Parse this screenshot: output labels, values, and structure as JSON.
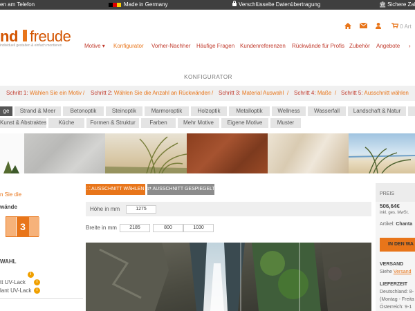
{
  "topbar": {
    "phone_text": "en am Telefon",
    "made_in": "Made in Germany",
    "secure": "Verschlüsselte Datenübertragung",
    "payment": "Sichere Zahl",
    "flag_colors": [
      "#000000",
      "#dd0000",
      "#ffce00"
    ]
  },
  "logo": {
    "text_a": "nd",
    "text_b": "freude",
    "tagline": "individuell gestalten & einfach montieren"
  },
  "header_icons": [
    "home-icon",
    "mail-icon",
    "user-icon"
  ],
  "cart": {
    "icon": "cart-icon",
    "count": "0",
    "label": "Art"
  },
  "nav": {
    "items": [
      "Motive ▾",
      "Konfigurator",
      "Vorher-Nachher",
      "Häufige Fragen",
      "Kundenreferenzen",
      "Rückwände für Profis",
      "Zubehör",
      "Angebote"
    ],
    "active": "Konfigurator"
  },
  "page_title": "KONFIGURATOR",
  "steps": [
    {
      "num": "Schritt 1:",
      "label": "Wählen Sie ein Motiv"
    },
    {
      "num": "Schritt 2:",
      "label": "Wählen Sie die Anzahl an Rückwänden"
    },
    {
      "num": "Schritt 3:",
      "label": "Material Auswahl"
    },
    {
      "num": "Schritt 4:",
      "label": "Maße"
    },
    {
      "num": "Schritt 5:",
      "label": "Ausschnitt wählen"
    }
  ],
  "categories_row1": [
    "ge",
    "Strand & Meer",
    "Betonoptik",
    "Steinoptik",
    "Marmoroptik",
    "Holzoptik",
    "Metalloptik",
    "Wellness",
    "Wasserfall",
    "Landschaft & Natur"
  ],
  "categories_row2": [
    "Kunst & Abstraktes",
    "Küche",
    "Formen & Struktur",
    "Farben",
    "Mehr Motive",
    "Eigene Motive",
    "Muster"
  ],
  "sidebar": {
    "motif_hint": "n Sie die",
    "walls_label": "wände",
    "walls_count": "3",
    "material_label": "WAHL",
    "material_1": "tt UV-Lack",
    "material_2": "lant UV-Lack",
    "info_glyph": "i"
  },
  "buttons": {
    "crop": "AUSSCHNITT WÄHLEN",
    "mirror": "AUSSCHNITT GESPIEGELT"
  },
  "form": {
    "height_label": "Höhe in mm",
    "height_value": "1275",
    "width_label": "Breite in mm",
    "width_values": [
      "2185",
      "800",
      "1030"
    ]
  },
  "price_panel": {
    "price_label": "PREIS",
    "price": "506,64€",
    "vat": "inkl. ges. MwSt.",
    "article_label": "Artikel:",
    "article": "Chanta",
    "cart_button": "IN DEN WA",
    "shipping_label": "VERSAND",
    "shipping_text": "Siehe",
    "shipping_link": "Versand",
    "delivery_label": "LIEFERZEIT",
    "delivery_line1": "Deutschland: 8-",
    "delivery_line2": "(Montag - Freita",
    "delivery_line3": "Österreich: 9-1"
  },
  "colors": {
    "accent": "#e8751a",
    "nav_red": "#c0392b",
    "topbar_bg": "#3f3f3f"
  }
}
